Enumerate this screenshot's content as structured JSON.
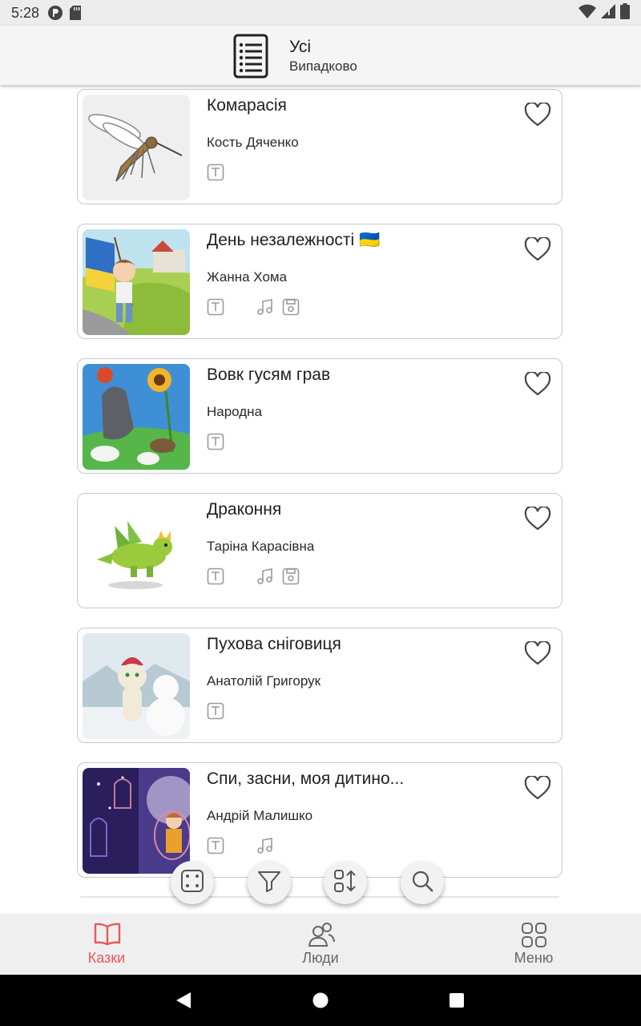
{
  "status_bar": {
    "time": "5:28"
  },
  "header": {
    "title": "Усі",
    "subtitle": "Випадково"
  },
  "stories": [
    {
      "title": "Комарасія",
      "author": "Кость Дяченко",
      "formats": [
        "text"
      ]
    },
    {
      "title": "День незалежності 🇺🇦",
      "author": "Жанна Хома",
      "formats": [
        "text",
        "audio",
        "saved"
      ]
    },
    {
      "title": "Вовк гусям грав",
      "author": "Народна",
      "formats": [
        "text"
      ]
    },
    {
      "title": "Драконня",
      "author": "Таріна Карасівна",
      "formats": [
        "text",
        "audio",
        "saved"
      ]
    },
    {
      "title": "Пухова сніговиця",
      "author": "Анатолій Григорук",
      "formats": [
        "text"
      ]
    },
    {
      "title": "Спи, засни, моя дитино...",
      "author": "Андрій Малишко",
      "formats": [
        "text",
        "audio"
      ]
    }
  ],
  "fabs": [
    "dice-icon",
    "filter-icon",
    "sort-icon",
    "search-icon"
  ],
  "bottom_nav": {
    "items": [
      {
        "label": "Казки",
        "icon": "book-icon",
        "active": true
      },
      {
        "label": "Люди",
        "icon": "people-icon",
        "active": false
      },
      {
        "label": "Меню",
        "icon": "grid-icon",
        "active": false
      }
    ]
  },
  "colors": {
    "accent": "#e8585e",
    "inactive": "#666666",
    "icon_gray": "#9a9a9a"
  }
}
